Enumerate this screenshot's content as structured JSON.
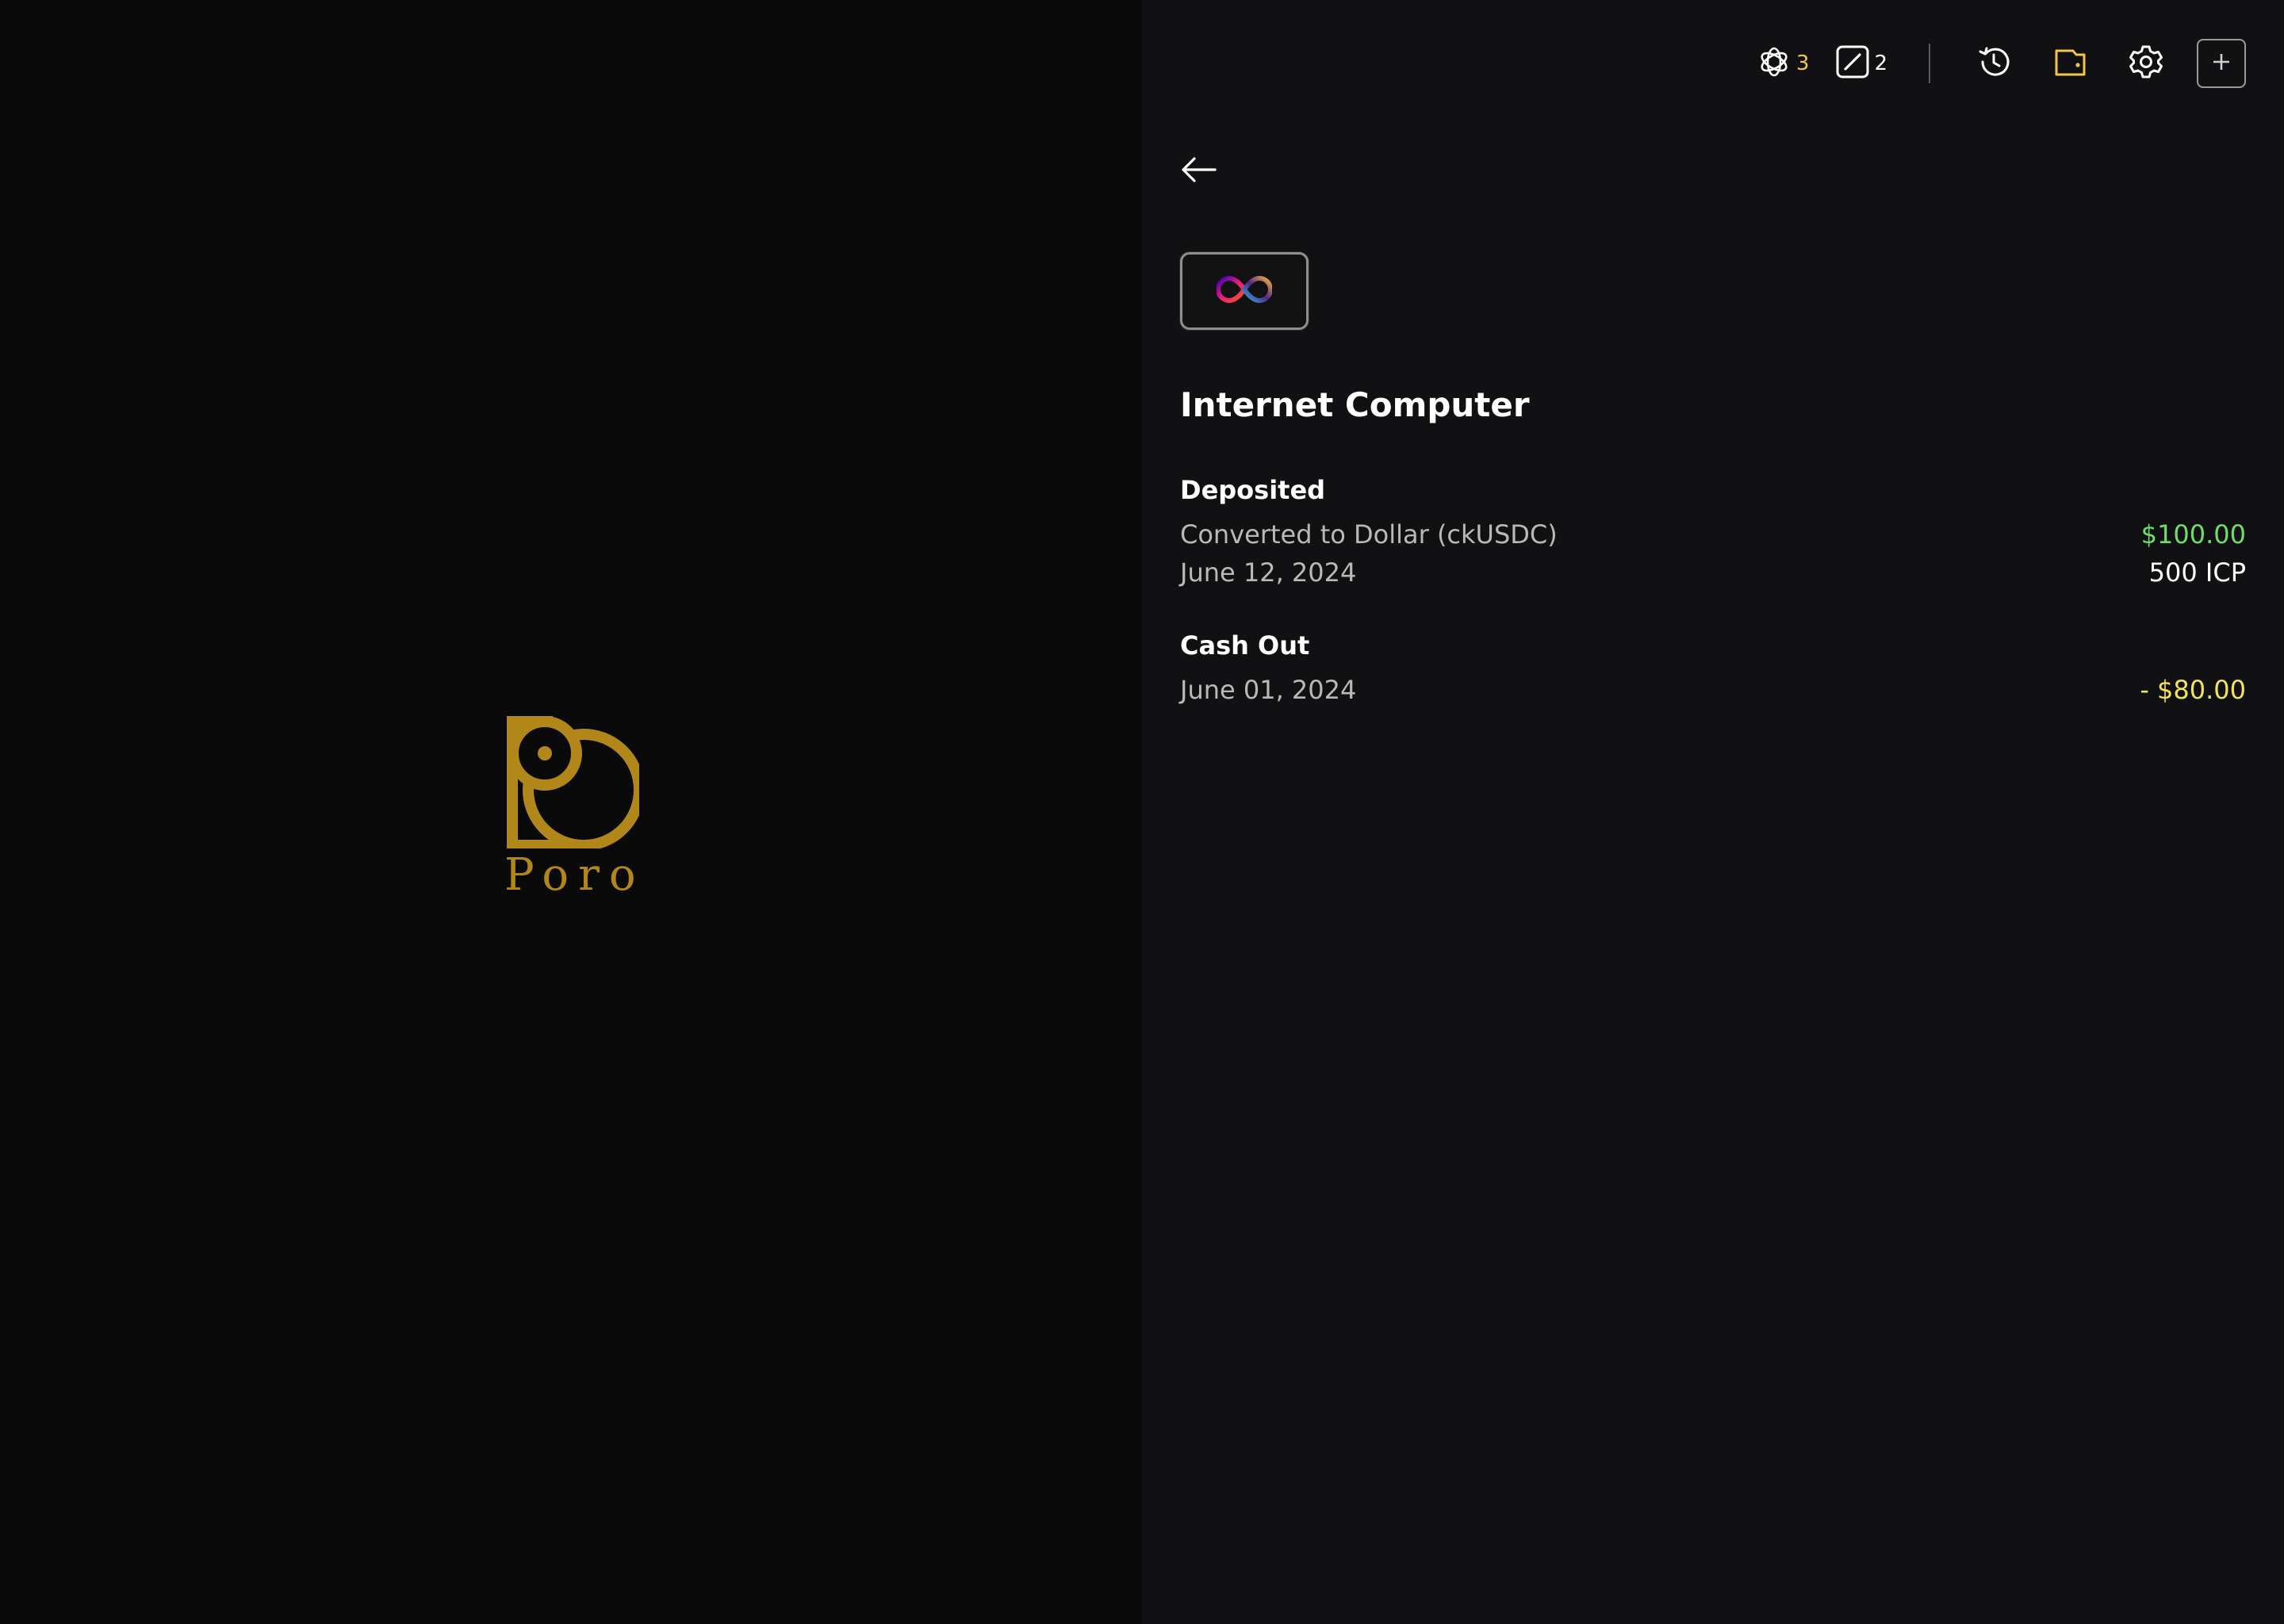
{
  "app": {
    "brand_name": "Poro"
  },
  "topbar": {
    "ai_badge": {
      "icon": "openai-icon",
      "count": "3",
      "count_color": "#f0c64b"
    },
    "edit_badge": {
      "icon": "edit-square-icon",
      "count": "2",
      "count_color": "#ffffff"
    },
    "history_icon": "history-icon",
    "wallet_icon": "wallet-icon",
    "settings_icon": "gear-icon",
    "add_icon": "plus-icon"
  },
  "detail": {
    "back_icon": "arrow-left-icon",
    "token_icon": "icp-infinity-logo",
    "token_name": "Internet Computer",
    "transactions": [
      {
        "title": "Deposited",
        "description": "Converted to Dollar (ckUSDC)",
        "amount": "$100.00",
        "amount_color": "#6fdd6c",
        "date": "June 12, 2024",
        "token_amount": "500 ICP"
      },
      {
        "title": "Cash Out",
        "date": "June 01, 2024",
        "amount": "- $80.00",
        "amount_color": "#f3e35b"
      }
    ]
  },
  "colors": {
    "brand_gold": "#b1871a",
    "accent_yellow": "#f0c64b",
    "positive_green": "#6fdd6c",
    "negative_yellow": "#f3e35b"
  }
}
